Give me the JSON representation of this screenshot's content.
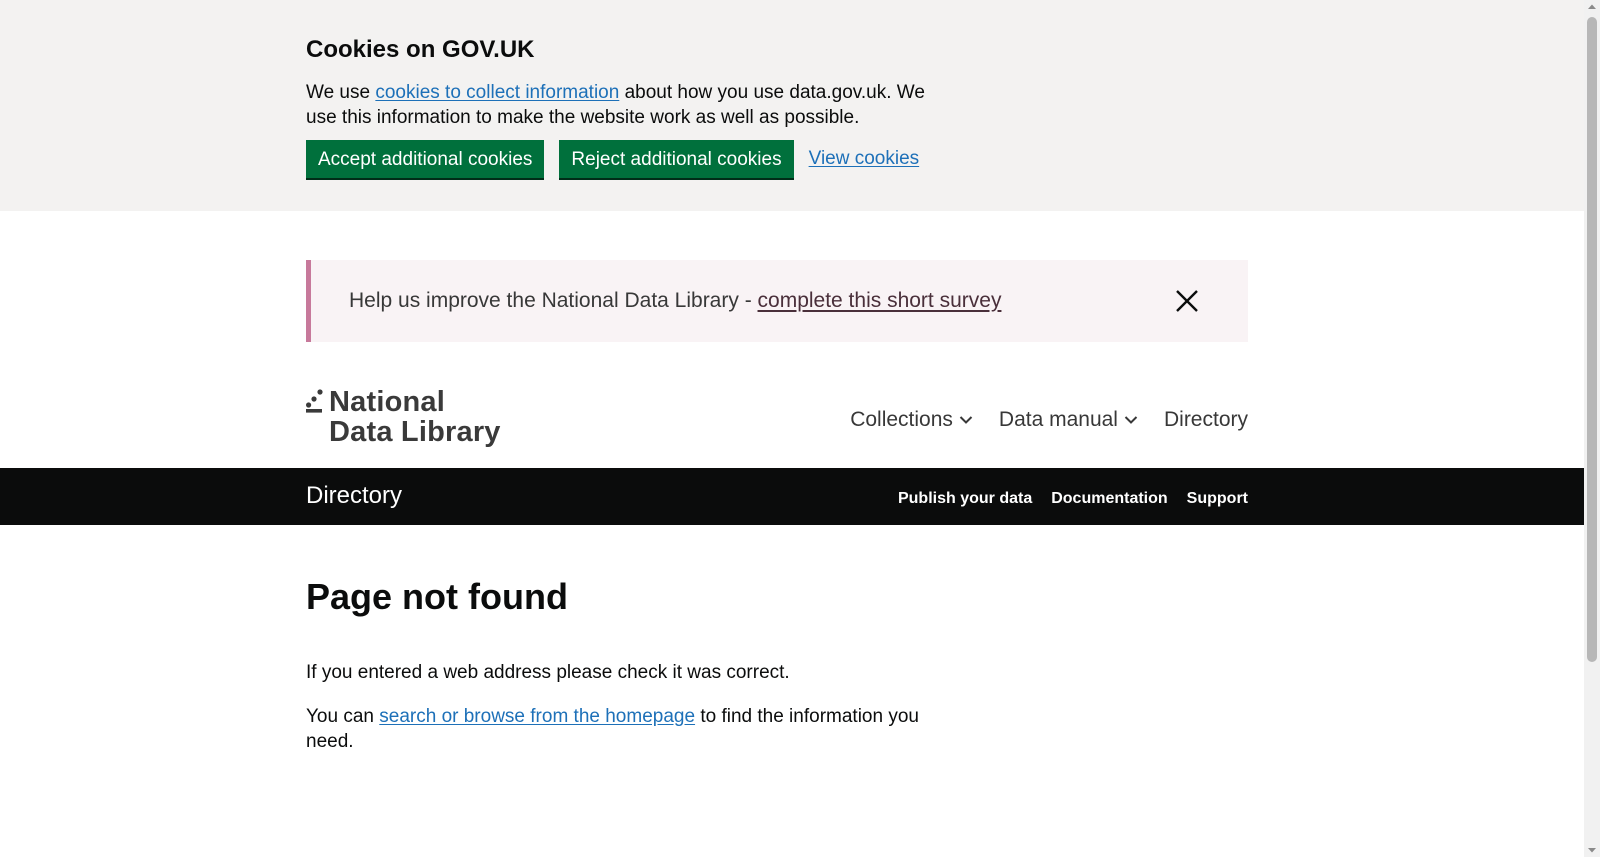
{
  "cookie_banner": {
    "title": "Cookies on GOV.UK",
    "text_before_link": "We use ",
    "link_text": "cookies to collect information",
    "text_after_link": " about how you use data.gov.uk. We use this information to make the website work as well as possible.",
    "accept_label": "Accept additional cookies",
    "reject_label": "Reject additional cookies",
    "view_label": "View cookies"
  },
  "survey_banner": {
    "text": "Help us improve the National Data Library - ",
    "link_text": "complete this short survey",
    "close_icon": "close-icon"
  },
  "header": {
    "logo_line1": "National",
    "logo_line2": "Data Library",
    "nav": [
      {
        "label": "Collections",
        "icon": "chevron-down-icon"
      },
      {
        "label": "Data manual",
        "icon": "chevron-down-icon"
      },
      {
        "label": "Directory"
      }
    ]
  },
  "sub_bar": {
    "title": "Directory",
    "links": [
      "Publish your data",
      "Documentation",
      "Support"
    ]
  },
  "main": {
    "title": "Page not found",
    "p1": "If you entered a web address please check it was correct.",
    "p2_before_link": "You can ",
    "p2_link": "search or browse from the homepage",
    "p2_after_link": " to find the information you need."
  },
  "colors": {
    "green_button": "#00703c",
    "link_blue": "#1d70b8",
    "survey_accent": "#c7799b",
    "survey_bg": "#f9f3f5",
    "cookie_bg": "#f3f2f1",
    "bar_bg": "#0b0c0c"
  }
}
